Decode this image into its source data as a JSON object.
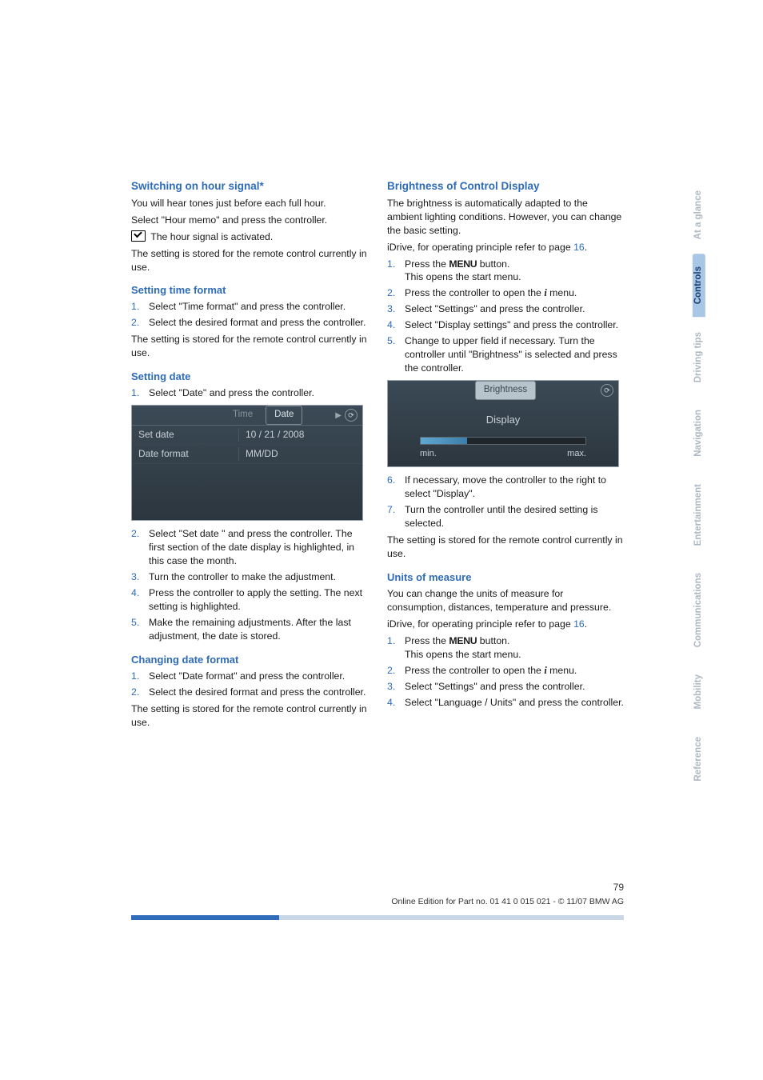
{
  "leftCol": {
    "h_hour": "Switching on hour signal*",
    "hour_p1": "You will hear tones just before each full hour.",
    "hour_p2": "Select \"Hour memo\" and press the controller.",
    "hour_p3": "The hour signal is activated.",
    "hour_p4": "The setting is stored for the remote control currently in use.",
    "h_timefmt": "Setting time format",
    "timefmt_s1": "Select \"Time format\" and press the controller.",
    "timefmt_s2": "Select the desired format and press the controller.",
    "timefmt_p": "The setting is stored for the remote control currently in use.",
    "h_date": "Setting date",
    "date_s1": "Select \"Date\" and press the controller.",
    "date_s2": "Select \"Set date \" and press the controller. The first section of the date display is highlighted, in this case the month.",
    "date_s3": "Turn the controller to make the adjustment.",
    "date_s4": "Press the controller to apply the setting. The next setting is highlighted.",
    "date_s5": "Make the remaining adjustments. After the last adjustment, the date is stored.",
    "h_changedate": "Changing date format",
    "cdf_s1": "Select \"Date format\" and press the controller.",
    "cdf_s2": "Select the desired format and press the controller.",
    "cdf_p": "The setting is stored for the remote control currently in use.",
    "shot_date": {
      "tab_time": "Time",
      "tab_date": "Date",
      "row1_l": "Set date",
      "row1_r": "10 / 21 / 2008",
      "row2_l": "Date format",
      "row2_r": "MM/DD"
    }
  },
  "rightCol": {
    "h_bright": "Brightness of Control Display",
    "bright_p1": "The brightness is automatically adapted to the ambient lighting conditions. However, you can change the basic setting.",
    "idrive_prefix": "iDrive, for operating principle refer to page ",
    "pageref": "16",
    "bright_s1a": "Press the ",
    "bright_s1b": " button.",
    "bright_s1c": "This opens the start menu.",
    "bright_s2a": "Press the controller to open the ",
    "bright_s2b": " menu.",
    "bright_s3": "Select \"Settings\" and press the controller.",
    "bright_s4": "Select \"Display settings\" and press the controller.",
    "bright_s5": "Change to upper field if necessary. Turn the controller until \"Brightness\" is selected and press the controller.",
    "bright_s6": "If necessary, move the controller to the right to select \"Display\".",
    "bright_s7": "Turn the controller until the desired setting is selected.",
    "bright_p2": "The setting is stored for the remote control currently in use.",
    "h_units": "Units of measure",
    "units_p1": "You can change the units of measure for consumption, distances, temperature and pressure.",
    "units_s1a": "Press the ",
    "units_s1b": " button.",
    "units_s1c": "This opens the start menu.",
    "units_s2a": "Press the controller to open the ",
    "units_s2b": " menu.",
    "units_s3": "Select \"Settings\" and press the controller.",
    "units_s4": "Select \"Language / Units\" and press the controller.",
    "shot_bright": {
      "tab": "Brightness",
      "display": "Display",
      "min": "min.",
      "max": "max."
    },
    "menu_word": "MENU",
    "info_glyph": "i"
  },
  "sideTabs": [
    "At a glance",
    "Controls",
    "Driving tips",
    "Navigation",
    "Entertainment",
    "Communications",
    "Mobility",
    "Reference"
  ],
  "activeTabIndex": 1,
  "footer": {
    "pagenum": "79",
    "line": "Online Edition for Part no. 01 41 0 015 021 - © 11/07 BMW AG"
  }
}
